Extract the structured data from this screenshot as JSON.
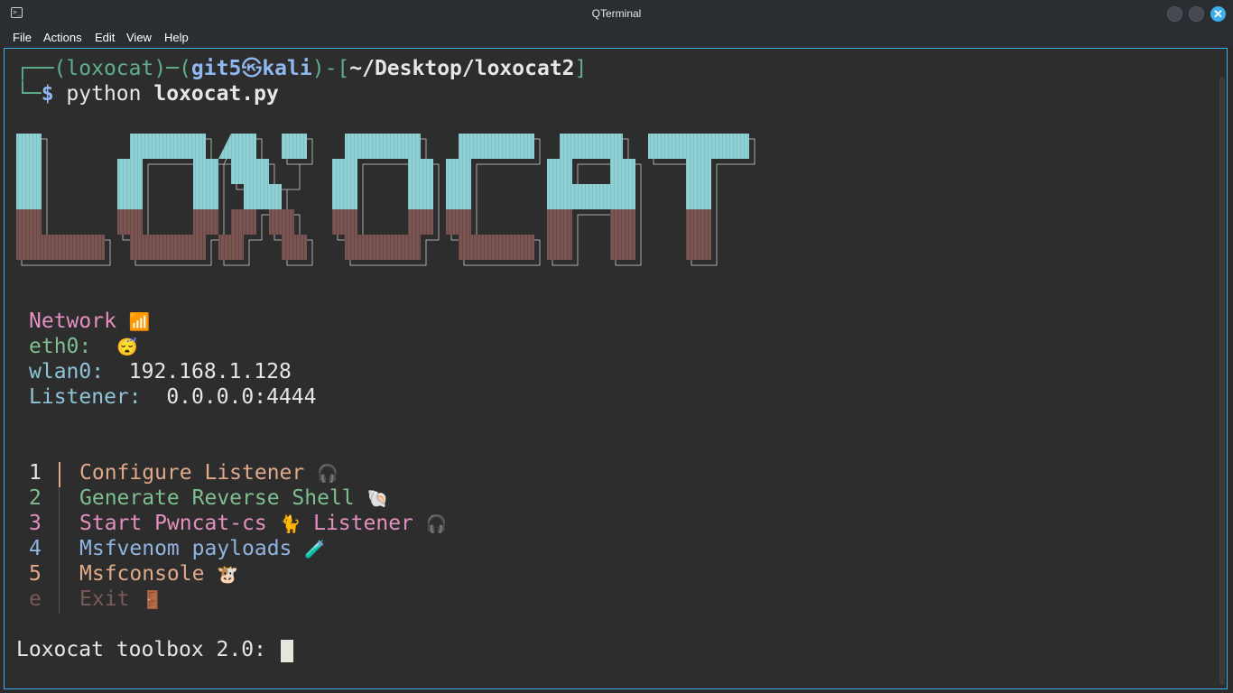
{
  "window": {
    "title": "QTerminal",
    "app_icon_glyph": ">_",
    "close_glyph": "✕"
  },
  "menubar": {
    "items": [
      "File",
      "Actions",
      "Edit",
      "View",
      "Help"
    ]
  },
  "prompt": {
    "corner_top": "┌──",
    "paren_open": "(",
    "user": "loxocat",
    "paren_close": ")",
    "dash": "─",
    "paren_open2": "(",
    "host_prefix": "git5",
    "at_symbol": "㉿",
    "host": "kali",
    "paren_close2": ")",
    "bracket_open": "-[",
    "path": "~/Desktop/loxocat2",
    "bracket_close": "]",
    "corner_bottom": "└─",
    "dollar": "$",
    "command": "python",
    "arg": "loxocat.py"
  },
  "banner": {
    "text": "LOXOCAT",
    "top_color": "#8fd0d4",
    "bottom_color": "#7a5353"
  },
  "network": {
    "heading": "Network",
    "heading_icon": "📶",
    "eth0_label": "eth0:",
    "eth0_value": "😴",
    "wlan0_label": "wlan0:",
    "wlan0_value": "192.168.1.128",
    "listener_label": "Listener:",
    "listener_value": "0.0.0.0:4444"
  },
  "menu": [
    {
      "key": "1",
      "label": "Configure Listener",
      "icon": "🎧",
      "color": "#e0a98a"
    },
    {
      "key": "2",
      "label": "Generate Reverse Shell",
      "icon": "🐚",
      "color": "#7fbf8f"
    },
    {
      "key": "3",
      "label": "Start Pwncat-cs",
      "icon": "🐈",
      "label2": "Listener",
      "icon2": "🎧",
      "color": "#e58fc0"
    },
    {
      "key": "4",
      "label": "Msfvenom payloads",
      "icon": "🧪",
      "color": "#8fb4e0"
    },
    {
      "key": "5",
      "label": "Msfconsole",
      "icon": "🐮",
      "color": "#e0a98a"
    },
    {
      "key": "e",
      "label": "Exit",
      "icon": "🚪",
      "color": "#7a5a58"
    }
  ],
  "input_prompt": "Loxocat toolbox 2.0:",
  "colors": {
    "accent": "#3daee9",
    "prompt_green": "#5fb08a",
    "prompt_blue": "#8fb8f0",
    "heading_pink": "#e58fc0",
    "label_green": "#7fbf8f",
    "label_blue": "#8fc4d8",
    "text": "#e6e6e6"
  }
}
